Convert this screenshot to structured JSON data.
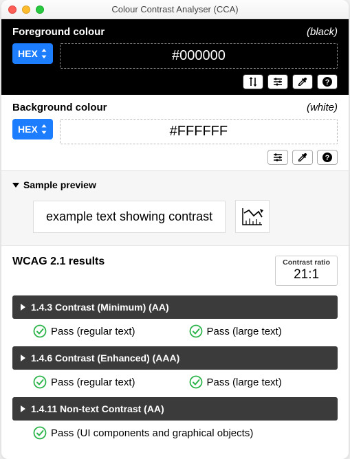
{
  "window": {
    "title": "Colour Contrast Analyser (CCA)"
  },
  "foreground": {
    "label": "Foreground colour",
    "colorName": "(black)",
    "format": "HEX",
    "value": "#000000"
  },
  "background": {
    "label": "Background colour",
    "colorName": "(white)",
    "format": "HEX",
    "value": "#FFFFFF"
  },
  "preview": {
    "label": "Sample preview",
    "text": "example text showing contrast"
  },
  "results": {
    "title": "WCAG 2.1 results",
    "ratioLabel": "Contrast ratio",
    "ratioValue": "21:1",
    "criteria": [
      {
        "label": "1.4.3 Contrast (Minimum) (AA)",
        "passes": [
          {
            "text": "Pass (regular text)"
          },
          {
            "text": "Pass (large text)"
          }
        ]
      },
      {
        "label": "1.4.6 Contrast (Enhanced) (AAA)",
        "passes": [
          {
            "text": "Pass (regular text)"
          },
          {
            "text": "Pass (large text)"
          }
        ]
      },
      {
        "label": "1.4.11 Non-text Contrast (AA)",
        "passes": [
          {
            "text": "Pass (UI components and graphical objects)"
          }
        ]
      }
    ]
  }
}
